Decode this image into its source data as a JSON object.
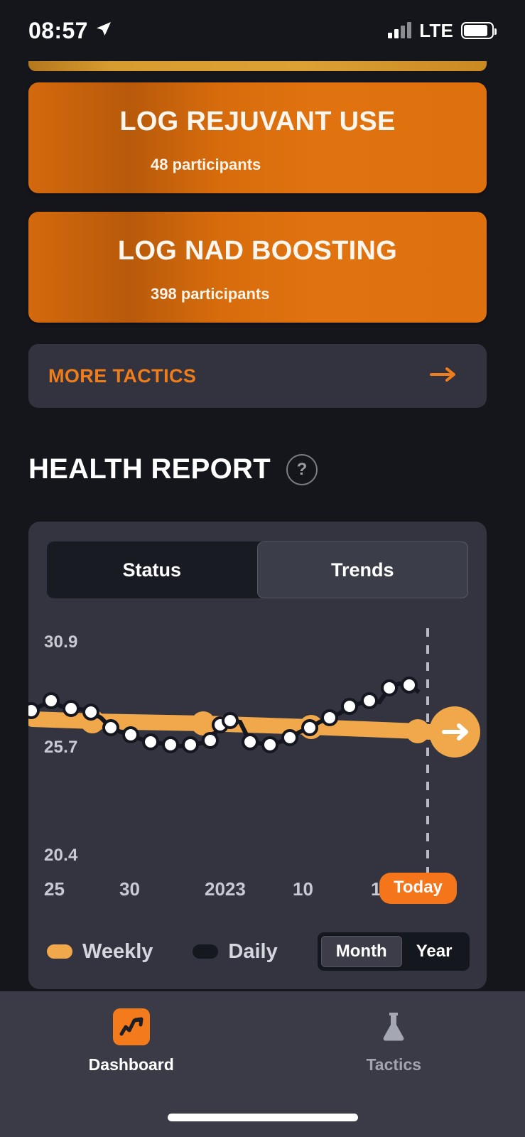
{
  "status_bar": {
    "time": "08:57",
    "location_icon": "location-arrow-icon",
    "network": "LTE",
    "signal_icon": "signal-bars-icon",
    "battery_icon": "battery-icon"
  },
  "tactic_cards": [
    {
      "title": "LOG REJUVANT USE",
      "participants": "48 participants"
    },
    {
      "title": "LOG NAD BOOSTING",
      "participants": "398 participants"
    }
  ],
  "more_tactics": {
    "label": "MORE TACTICS",
    "arrow_icon": "arrow-right-icon"
  },
  "health_report": {
    "title": "HEALTH REPORT",
    "help_label": "?",
    "tabs": [
      {
        "label": "Status",
        "active": false
      },
      {
        "label": "Trends",
        "active": true
      }
    ],
    "legend": [
      {
        "label": "Weekly",
        "color": "#f0a84a"
      },
      {
        "label": "Daily",
        "color": "#16181f"
      }
    ],
    "range": [
      {
        "label": "Month",
        "active": true
      },
      {
        "label": "Year",
        "active": false
      }
    ],
    "today_marker": "Today",
    "end_arrow_icon": "arrow-right-circle-icon"
  },
  "chart_data": {
    "type": "line",
    "title": "HEALTH REPORT",
    "xlabel": "",
    "ylabel": "",
    "ylim": [
      20.4,
      30.9
    ],
    "ytick_labels": [
      "30.9",
      "25.7",
      "20.4"
    ],
    "ytick_values": [
      30.9,
      25.7,
      20.4
    ],
    "xtick_labels": [
      "25",
      "30",
      "2023",
      "10",
      "15"
    ],
    "grid": false,
    "legend_position": "bottom-left",
    "annotations": [
      {
        "text": "Today",
        "type": "vertical-dashed-line",
        "x_fraction": 0.875
      }
    ],
    "series": [
      {
        "name": "Weekly",
        "color": "#f0a84a",
        "marker": "circle",
        "x": [
          0,
          0.1,
          0.3,
          0.52,
          0.72,
          0.875
        ],
        "values": [
          26.55,
          26.5,
          26.42,
          26.3,
          26.18,
          26.05
        ]
      },
      {
        "name": "Daily",
        "color": "#16181f",
        "marker": "white-dot",
        "x": [
          0.0,
          0.022,
          0.045,
          0.068,
          0.09,
          0.113,
          0.135,
          0.158,
          0.18,
          0.203,
          0.225,
          0.248,
          0.27,
          0.293,
          0.315,
          0.338,
          0.36,
          0.383,
          0.405,
          0.428,
          0.45,
          0.473,
          0.495,
          0.518,
          0.54,
          0.563,
          0.585,
          0.608,
          0.63,
          0.653,
          0.675,
          0.698,
          0.72,
          0.743,
          0.765,
          0.788,
          0.81,
          0.833,
          0.855,
          0.878
        ],
        "values": [
          26.7,
          26.85,
          27.0,
          26.8,
          26.75,
          26.72,
          26.65,
          26.45,
          26.1,
          25.95,
          25.85,
          25.7,
          25.6,
          25.55,
          25.5,
          25.45,
          25.5,
          25.55,
          25.65,
          26.2,
          26.35,
          26.3,
          25.6,
          25.55,
          25.5,
          25.6,
          25.75,
          25.95,
          26.1,
          26.3,
          26.45,
          26.6,
          26.85,
          26.95,
          27.05,
          27.0,
          27.5,
          27.65,
          27.6,
          27.35
        ]
      }
    ]
  },
  "tab_bar": [
    {
      "label": "Dashboard",
      "icon": "chart-line-icon",
      "active": true
    },
    {
      "label": "Tactics",
      "icon": "flask-icon",
      "active": false
    }
  ]
}
